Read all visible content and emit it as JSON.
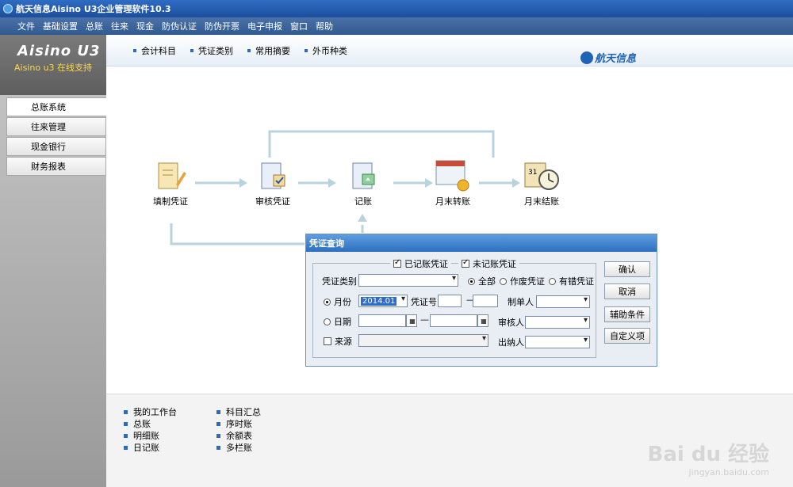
{
  "window": {
    "title": "航天信息Aisino U3企业管理软件10.3"
  },
  "menu": [
    "文件",
    "基础设置",
    "总账",
    "往来",
    "现金",
    "防伪认证",
    "防伪开票",
    "电子申报",
    "窗口",
    "帮助"
  ],
  "toolbar": {
    "items": [
      "会计科目",
      "凭证类别",
      "常用摘要",
      "外币种类"
    ]
  },
  "brand_right": "航天信息",
  "sidebar": {
    "logo": "Aisino U3",
    "support": "Aisino u3  在线支持",
    "items": [
      "总账系统",
      "往来管理",
      "现金银行",
      "财务报表"
    ]
  },
  "flow": {
    "steps": [
      "填制凭证",
      "审核凭证",
      "记账",
      "月末转账",
      "月末结账"
    ]
  },
  "quick_links": {
    "col1": [
      "我的工作台",
      "总账",
      "明细账",
      "日记账"
    ],
    "col2": [
      "科目汇总",
      "序时账",
      "余额表",
      "多栏账"
    ]
  },
  "dialog": {
    "title": "凭证查询",
    "checkbox_posted": "已记账凭证",
    "checkbox_unposted": "未记账凭证",
    "voucher_type_label": "凭证类别",
    "radio_all": "全部",
    "radio_void": "作废凭证",
    "radio_error": "有错凭证",
    "month_label": "月份",
    "month_value": "2014.01",
    "voucher_no_label": "凭证号",
    "dash": "—",
    "preparer_label": "制单人",
    "date_label": "日期",
    "reviewer_label": "审核人",
    "source_label": "来源",
    "cashier_label": "出纳人",
    "buttons": [
      "确认",
      "取消",
      "辅助条件",
      "自定义项"
    ]
  },
  "watermark": {
    "brand": "Bai du 经验",
    "url": "jingyan.baidu.com"
  }
}
